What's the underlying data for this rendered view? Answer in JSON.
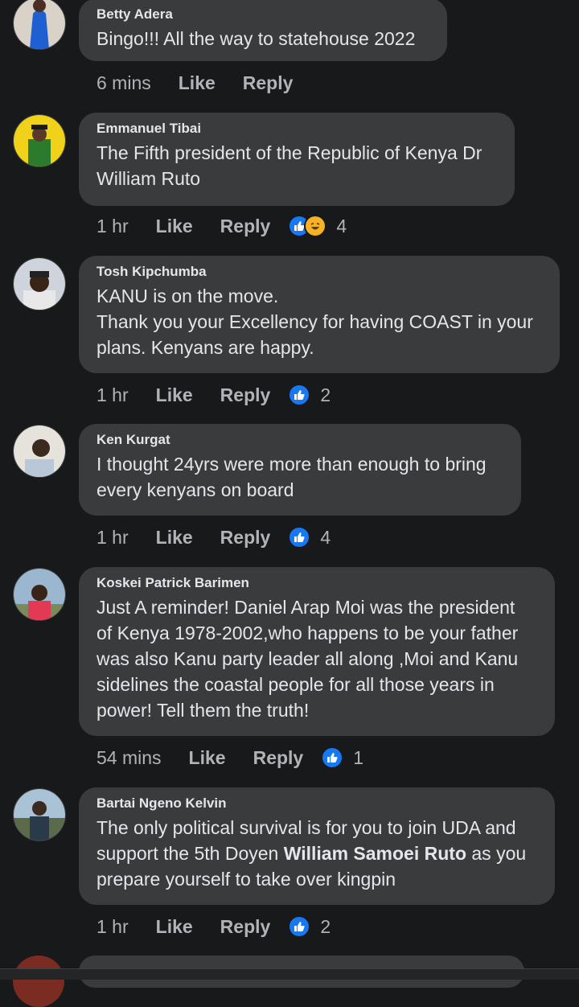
{
  "comments": [
    {
      "author": "Betty Adera",
      "text": "Bingo!!! All the way to statehouse 2022",
      "time": "6 mins",
      "like_label": "Like",
      "reply_label": "Reply",
      "reaction_count": ""
    },
    {
      "author": "Emmanuel Tibai",
      "text_lines": [
        "The Fifth president of the Republic of Kenya Dr",
        "William Ruto"
      ],
      "time": "1 hr",
      "like_label": "Like",
      "reply_label": "Reply",
      "reactions": [
        "like-icon",
        "haha-icon"
      ],
      "reaction_count": "4"
    },
    {
      "author": "Tosh Kipchumba",
      "text_lines": [
        "KANU is on the move.",
        "Thank you your Excellency for having COAST in your",
        "plans. Kenyans are happy."
      ],
      "time": "1 hr",
      "like_label": "Like",
      "reply_label": "Reply",
      "reactions": [
        "like-icon"
      ],
      "reaction_count": "2"
    },
    {
      "author": "Ken Kurgat",
      "text_lines": [
        "I thought 24yrs were more than enough to bring",
        "every kenyans on board"
      ],
      "time": "1 hr",
      "like_label": "Like",
      "reply_label": "Reply",
      "reactions": [
        "like-icon"
      ],
      "reaction_count": "4"
    },
    {
      "author": "Koskei Patrick Barimen",
      "text_lines": [
        "Just A reminder! Daniel Arap Moi was the president",
        "of Kenya 1978-2002,who happens to be your father",
        "was also Kanu party leader all along ,Moi and Kanu",
        "sidelines the coastal people for all those years in",
        "power! Tell them the truth!"
      ],
      "time": "54 mins",
      "like_label": "Like",
      "reply_label": "Reply",
      "reactions": [
        "like-icon"
      ],
      "reaction_count": "1"
    },
    {
      "author": "Bartai Ngeno Kelvin",
      "text_line1": "The only political survival is for you to join UDA and",
      "text_line2_a": "support the 5th Doyen ",
      "text_line2_bold": "William Samoei Ruto",
      "text_line2_b": " as you",
      "text_line3": "prepare yourself to take over kingpin",
      "time": "1 hr",
      "like_label": "Like",
      "reply_label": "Reply",
      "reactions": [
        "like-icon"
      ],
      "reaction_count": "2"
    }
  ],
  "colors": {
    "background": "#18191a",
    "bubble": "#3a3b3c",
    "text": "#e4e6eb",
    "meta": "#b0b3b8",
    "like_blue": "#1877f2",
    "haha_yellow": "#f7b125"
  }
}
